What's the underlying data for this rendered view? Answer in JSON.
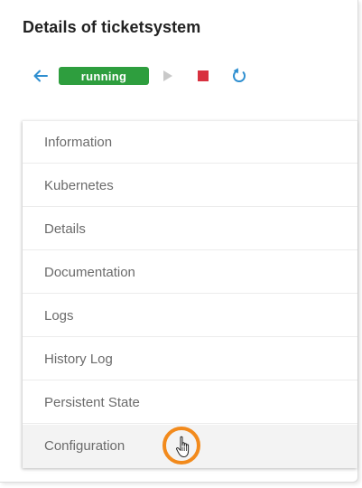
{
  "page": {
    "title": "Details of ticketsystem"
  },
  "toolbar": {
    "back_icon": "arrow-left-icon",
    "status": "running",
    "status_color": "#2e9e3e",
    "play_icon": "play-icon",
    "stop_icon": "stop-icon",
    "stop_color": "#d8313f",
    "restart_icon": "restart-icon",
    "accent_color": "#2f8fd0"
  },
  "menu": {
    "items": [
      {
        "label": "Information"
      },
      {
        "label": "Kubernetes"
      },
      {
        "label": "Details"
      },
      {
        "label": "Documentation"
      },
      {
        "label": "Logs"
      },
      {
        "label": "History Log"
      },
      {
        "label": "Persistent State"
      },
      {
        "label": "Configuration",
        "hovered": true
      }
    ]
  },
  "pointer": {
    "icon": "hand-pointer-icon",
    "highlight_color": "#f28a1c"
  }
}
